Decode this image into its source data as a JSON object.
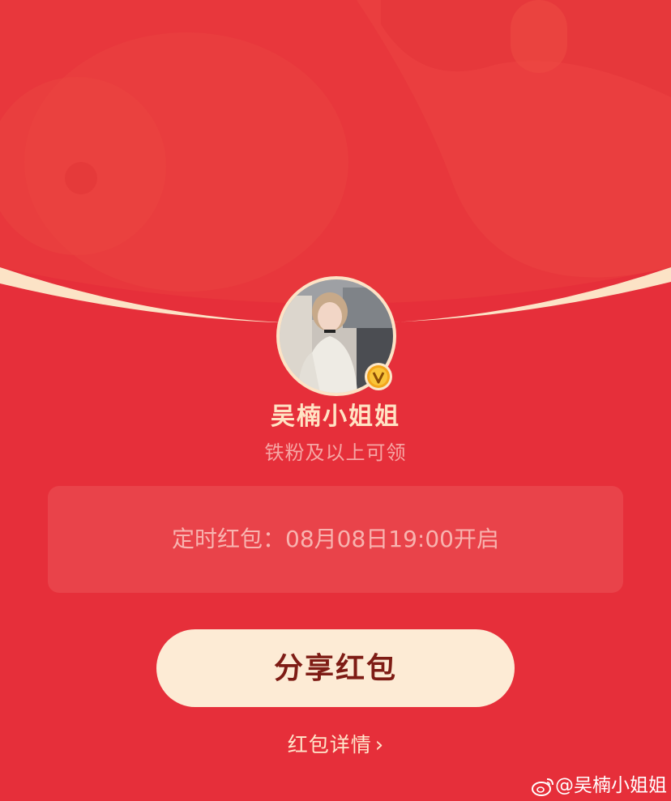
{
  "colors": {
    "background": "#E62F3A",
    "arc": "#FCE3C6",
    "primary_text": "#FFE3C4",
    "button_bg": "#FDEBD5",
    "button_text": "#7E1C15"
  },
  "profile": {
    "name": "吴楠小姐姐",
    "badge_icon": "verified-v-icon",
    "condition": "铁粉及以上可领"
  },
  "timer": {
    "text": "定时红包：08月08日19:00开启"
  },
  "actions": {
    "share_label": "分享红包",
    "details_label": "红包详情",
    "details_chevron": "›"
  },
  "watermark": {
    "icon": "weibo-icon",
    "text": "@吴楠小姐姐"
  }
}
